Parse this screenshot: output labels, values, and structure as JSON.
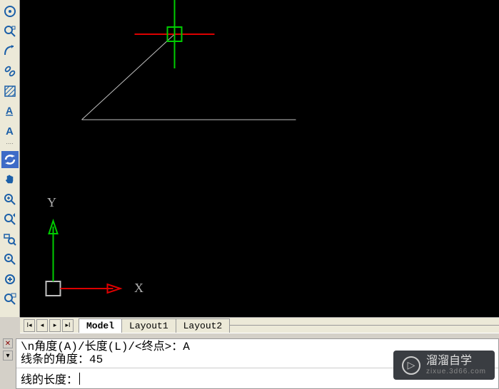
{
  "toolbar": {
    "items": [
      "circle-target",
      "zoom-box",
      "arc",
      "chain",
      "hatch",
      "text-underline",
      "text-plain",
      "refresh",
      "pan-hand",
      "zoom-plus",
      "zoom-realtime",
      "zoom-extents",
      "zoom-window",
      "zoom-in",
      "zoom-out"
    ]
  },
  "ucs": {
    "x_label": "X",
    "y_label": "Y"
  },
  "tabs": {
    "model": "Model",
    "layout1": "Layout1",
    "layout2": "Layout2"
  },
  "command": {
    "history_line1": "\\n角度(A)/长度(L)/<终点>：A",
    "history_line2": "线条的角度：45",
    "prompt": "线的长度："
  },
  "watermark": {
    "title": "溜溜自学",
    "sub": "zixue.3d66.com",
    "logo": "▷"
  }
}
